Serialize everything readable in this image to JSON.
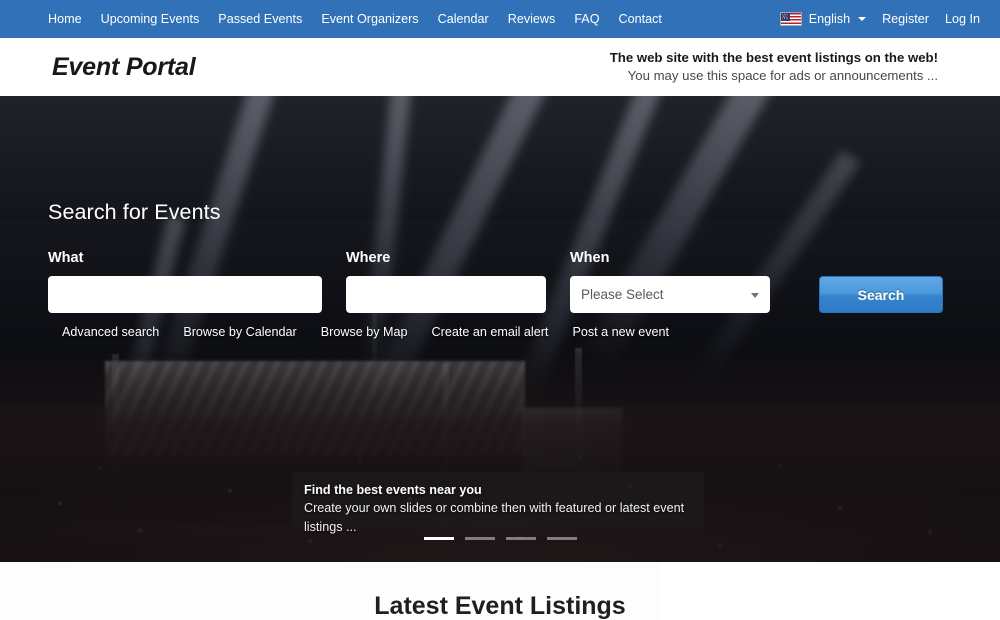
{
  "topnav": {
    "links": [
      {
        "label": "Home",
        "name": "nav-link-home"
      },
      {
        "label": "Upcoming Events",
        "name": "nav-link-upcoming-events"
      },
      {
        "label": "Passed Events",
        "name": "nav-link-passed-events"
      },
      {
        "label": "Event Organizers",
        "name": "nav-link-event-organizers"
      },
      {
        "label": "Calendar",
        "name": "nav-link-calendar"
      },
      {
        "label": "Reviews",
        "name": "nav-link-reviews"
      },
      {
        "label": "FAQ",
        "name": "nav-link-faq"
      },
      {
        "label": "Contact",
        "name": "nav-link-contact"
      }
    ],
    "language": "English",
    "language_icon": "us-flag-icon",
    "caret_icon": "chevron-down-icon",
    "register": "Register",
    "login": "Log In",
    "background_color": "#3071b8"
  },
  "header": {
    "logo": "Event Portal",
    "tagline_main": "The web site with the best event listings on the web!",
    "tagline_sub": "You may use this space for ads or announcements ..."
  },
  "hero": {
    "title": "Search for Events",
    "fields": {
      "what_label": "What",
      "what_value": "",
      "what_placeholder": "",
      "where_label": "Where",
      "where_value": "",
      "where_placeholder": "",
      "when_label": "When",
      "when_selected": "Please Select",
      "when_options": [
        "Please Select"
      ]
    },
    "search_button": "Search",
    "quick_links": [
      {
        "label": "Advanced search",
        "name": "quick-link-advanced-search"
      },
      {
        "label": "Browse by Calendar",
        "name": "quick-link-browse-by-calendar"
      },
      {
        "label": "Browse by Map",
        "name": "quick-link-browse-by-map"
      },
      {
        "label": "Create an email alert",
        "name": "quick-link-create-email-alert"
      },
      {
        "label": "Post a new event",
        "name": "quick-link-post-new-event"
      }
    ],
    "caption_title": "Find the best events near you",
    "caption_text": "Create your own slides or combine then with featured or latest event listings ...",
    "carousel": {
      "slide_count": 4,
      "active_index": 0
    },
    "accent_color": "#3683cd"
  },
  "main": {
    "section_title": "Latest Event Listings"
  }
}
